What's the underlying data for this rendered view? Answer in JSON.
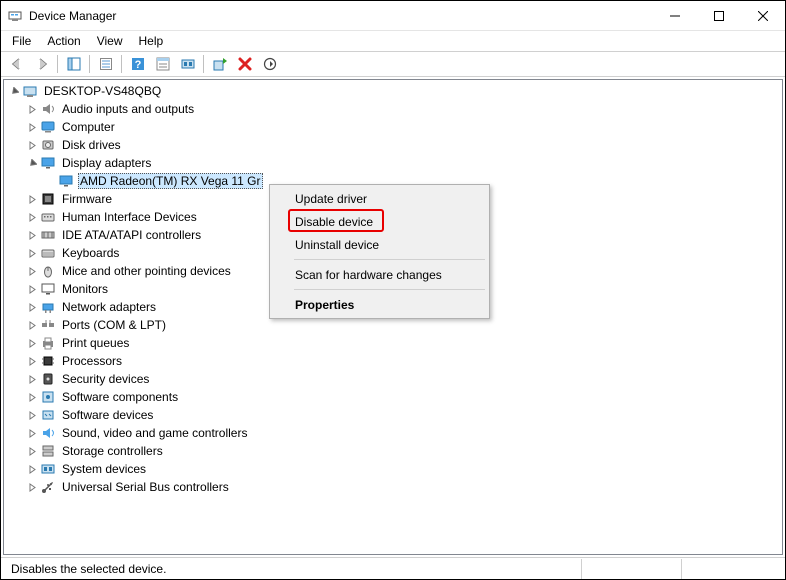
{
  "window_title": "Device Manager",
  "menu": {
    "file": "File",
    "action": "Action",
    "view": "View",
    "help": "Help"
  },
  "toolbar": {
    "back": "back",
    "forward": "forward",
    "show_hidden": "show-hidden",
    "properties": "properties",
    "help": "help",
    "show_console_tree": "console-tree",
    "scan": "scan",
    "update": "update-driver",
    "disable": "disable",
    "action_menu": "action-menu"
  },
  "tree": {
    "root": "DESKTOP-VS48QBQ",
    "categories": [
      {
        "label": "Audio inputs and outputs",
        "icon": "audio"
      },
      {
        "label": "Computer",
        "icon": "computer"
      },
      {
        "label": "Disk drives",
        "icon": "disk"
      },
      {
        "label": "Display adapters",
        "icon": "display",
        "expanded": true,
        "children": [
          {
            "label": "AMD Radeon(TM) RX Vega 11 Gr",
            "icon": "display"
          }
        ]
      },
      {
        "label": "Firmware",
        "icon": "firmware"
      },
      {
        "label": "Human Interface Devices",
        "icon": "hid"
      },
      {
        "label": "IDE ATA/ATAPI controllers",
        "icon": "ide"
      },
      {
        "label": "Keyboards",
        "icon": "keyboard"
      },
      {
        "label": "Mice and other pointing devices",
        "icon": "mouse"
      },
      {
        "label": "Monitors",
        "icon": "monitor"
      },
      {
        "label": "Network adapters",
        "icon": "network"
      },
      {
        "label": "Ports (COM & LPT)",
        "icon": "ports"
      },
      {
        "label": "Print queues",
        "icon": "printer"
      },
      {
        "label": "Processors",
        "icon": "cpu"
      },
      {
        "label": "Security devices",
        "icon": "security"
      },
      {
        "label": "Software components",
        "icon": "sw-comp"
      },
      {
        "label": "Software devices",
        "icon": "sw-dev"
      },
      {
        "label": "Sound, video and game controllers",
        "icon": "sound"
      },
      {
        "label": "Storage controllers",
        "icon": "storage"
      },
      {
        "label": "System devices",
        "icon": "system"
      },
      {
        "label": "Universal Serial Bus controllers",
        "icon": "usb"
      }
    ]
  },
  "context_menu": {
    "items": [
      {
        "label": "Update driver",
        "type": "item"
      },
      {
        "label": "Disable device",
        "type": "item",
        "highlighted": true
      },
      {
        "label": "Uninstall device",
        "type": "item"
      },
      {
        "type": "sep"
      },
      {
        "label": "Scan for hardware changes",
        "type": "item"
      },
      {
        "type": "sep"
      },
      {
        "label": "Properties",
        "type": "item",
        "bold": true
      }
    ]
  },
  "status": "Disables the selected device."
}
